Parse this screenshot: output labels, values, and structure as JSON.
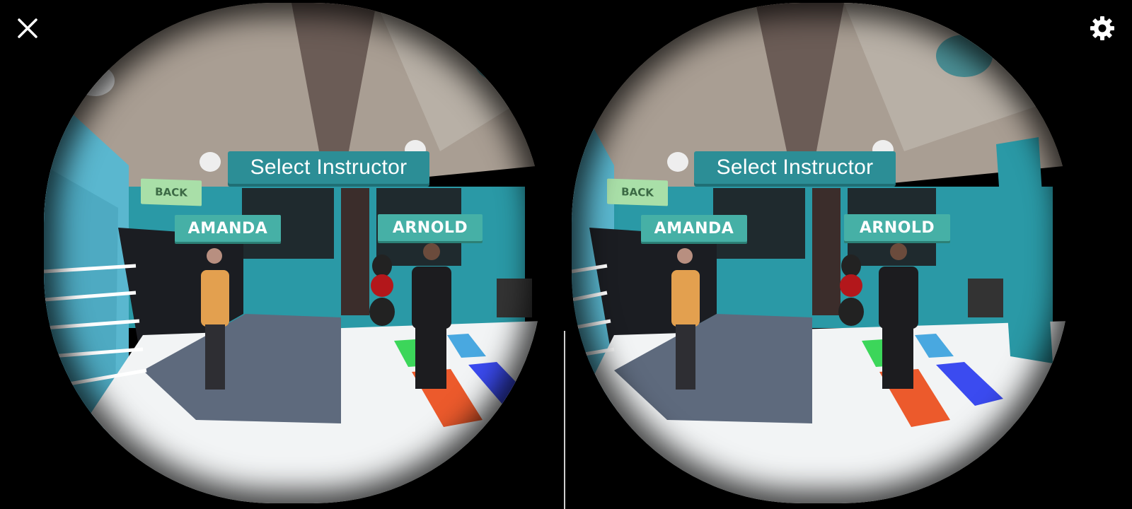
{
  "controls": {
    "close_icon": "close-icon",
    "settings_icon": "gear-icon"
  },
  "menu": {
    "title": "Select Instructor",
    "back_label": "BACK",
    "instructors": [
      {
        "label": "AMANDA"
      },
      {
        "label": "ARNOLD"
      }
    ]
  },
  "colors": {
    "banner": "#2c8e96",
    "instructor_button": "#46b0a6",
    "back_button": "#a9dfa8",
    "wall": "#5ab7cf",
    "ceiling": "#a99e93"
  }
}
